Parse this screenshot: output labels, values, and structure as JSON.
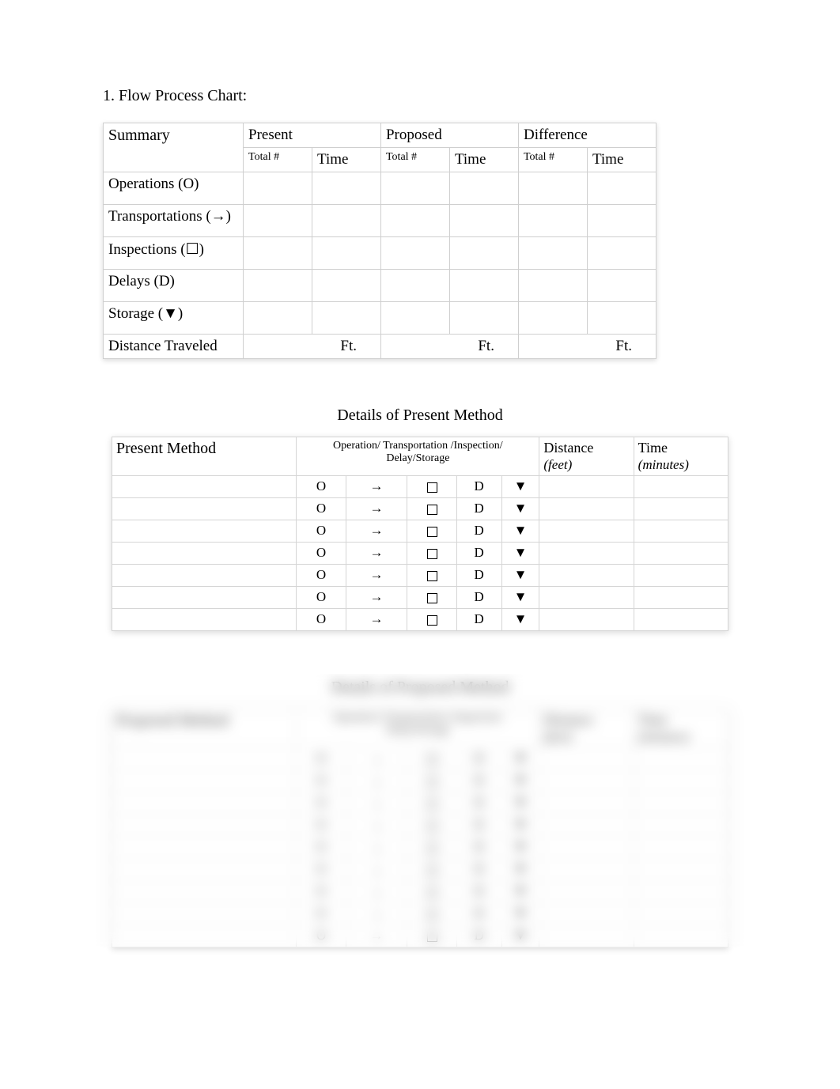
{
  "heading": "1. Flow Process Chart:",
  "summary": {
    "header": {
      "summary": "Summary",
      "present": "Present",
      "proposed": "Proposed",
      "difference": "Difference",
      "total": "Total #",
      "time": "Time"
    },
    "rows": [
      "Operations (O)",
      "Transportations (→)",
      "Inspections (☐)",
      "Delays (D)",
      "Storage (▼)"
    ],
    "distance_row": {
      "label": "Distance Traveled",
      "unit": "Ft."
    }
  },
  "details_present": {
    "title": "Details of Present Method",
    "left_header": "Present Method",
    "sym_header": "Operation/ Transportation /Inspection/ Delay/Storage",
    "distance_header": "Distance",
    "distance_unit": "(feet)",
    "time_header": "Time",
    "time_unit": "(minutes)",
    "symbols": [
      "O",
      "→",
      "☐",
      "D",
      "▼"
    ],
    "row_count": 7
  },
  "details_proposed": {
    "title": "Details of Proposed Method",
    "left_header": "Proposed Method",
    "sym_header": "Operation/ Transportation /Inspection/ Delay/Storage",
    "distance_header": "Distance",
    "distance_unit": "(feet)",
    "time_header": "Time",
    "time_unit": "(minutes)",
    "symbols": [
      "O",
      "→",
      "☐",
      "D",
      "▼"
    ],
    "row_count": 9
  }
}
